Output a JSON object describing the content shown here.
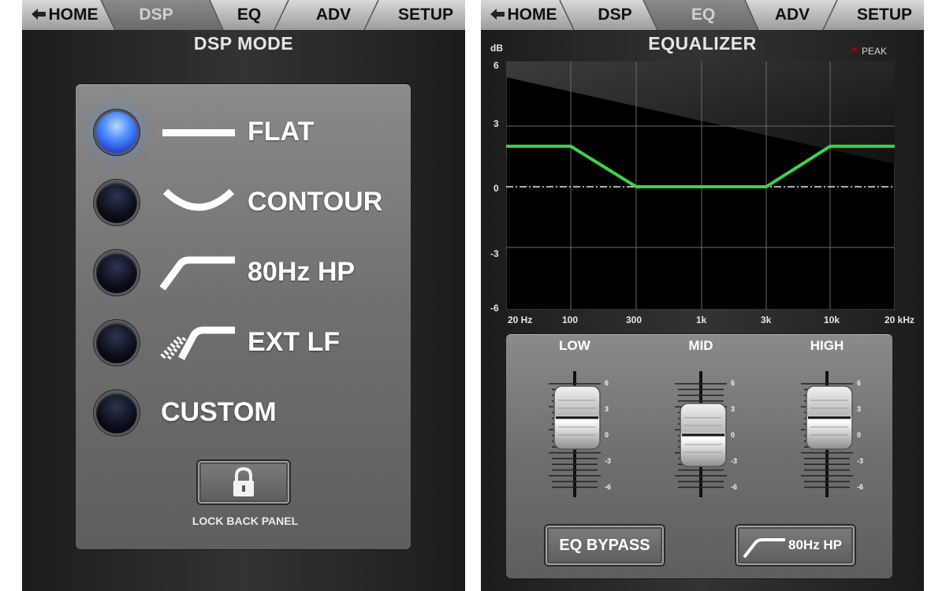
{
  "left_screen": {
    "tabs": [
      {
        "label": "HOME",
        "active": false,
        "icon": "back-arrow-icon"
      },
      {
        "label": "DSP",
        "active": true
      },
      {
        "label": "EQ",
        "active": false
      },
      {
        "label": "ADV",
        "active": false
      },
      {
        "label": "SETUP",
        "active": false
      }
    ],
    "title": "DSP MODE",
    "modes": [
      {
        "label": "FLAT",
        "selected": true,
        "icon": "flat-curve-icon"
      },
      {
        "label": "CONTOUR",
        "selected": false,
        "icon": "contour-curve-icon"
      },
      {
        "label": "80Hz HP",
        "selected": false,
        "icon": "highpass-curve-icon"
      },
      {
        "label": "EXT LF",
        "selected": false,
        "icon": "extended-lf-curve-icon"
      },
      {
        "label": "CUSTOM",
        "selected": false,
        "icon": ""
      }
    ],
    "lock": {
      "label": "LOCK BACK PANEL",
      "icon": "padlock-icon"
    }
  },
  "right_screen": {
    "tabs": [
      {
        "label": "HOME",
        "active": false,
        "icon": "back-arrow-icon"
      },
      {
        "label": "DSP",
        "active": false
      },
      {
        "label": "EQ",
        "active": true
      },
      {
        "label": "ADV",
        "active": false
      },
      {
        "label": "SETUP",
        "active": false
      }
    ],
    "title": "EQUALIZER",
    "peak_label": "PEAK",
    "db_unit": "dB",
    "db_ticks": [
      "6",
      "3",
      "0",
      "-3",
      "-6"
    ],
    "freq_ticks": [
      "20 Hz",
      "100",
      "300",
      "1k",
      "3k",
      "10k",
      "20 kHz"
    ],
    "faders": [
      {
        "label": "LOW",
        "gain_db": 2
      },
      {
        "label": "MID",
        "gain_db": 0
      },
      {
        "label": "HIGH",
        "gain_db": 2
      }
    ],
    "fader_scale": [
      "6",
      "3",
      "0",
      "-3",
      "-6"
    ],
    "buttons": {
      "bypass": "EQ BYPASS",
      "highpass": "80Hz HP"
    }
  },
  "colors": {
    "accent_led": "#4c8cff",
    "eq_curve": "#3fd24a",
    "active_tab_text": "#d0d0d0",
    "tab_text": "#111111"
  }
}
